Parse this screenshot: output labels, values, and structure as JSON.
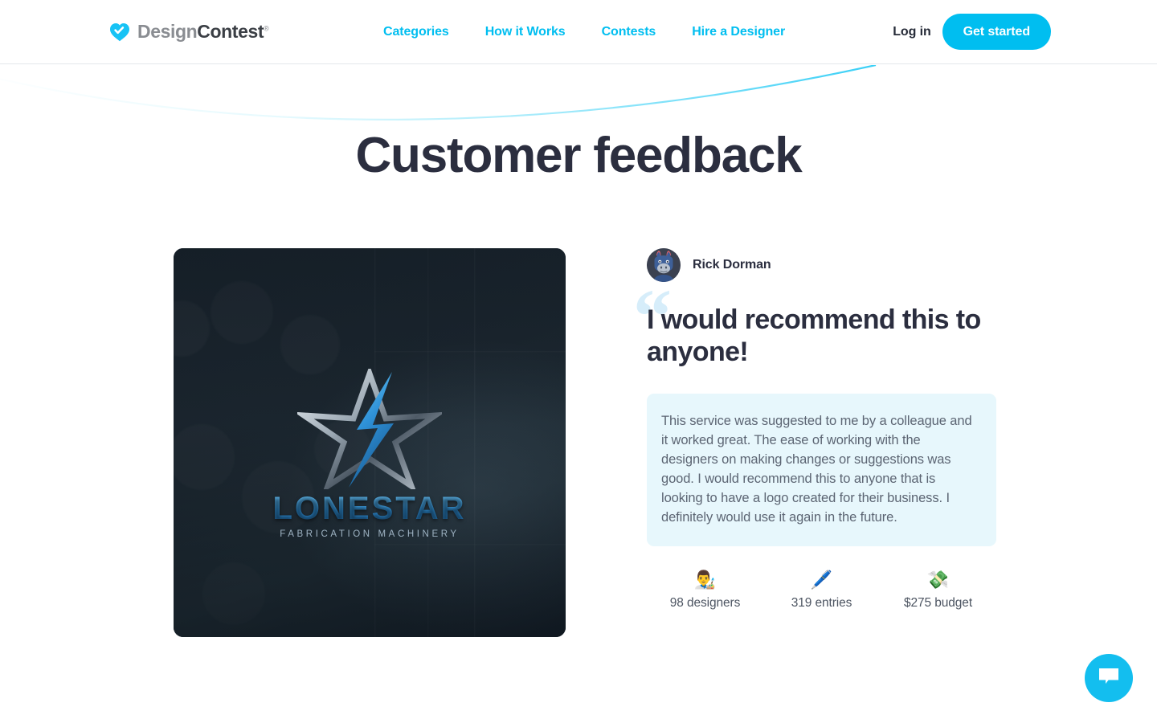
{
  "header": {
    "brand": {
      "icon": "heart-check-icon",
      "text_light": "Design",
      "text_dark": "Contest",
      "registered": "®"
    },
    "nav": [
      {
        "label": "Categories"
      },
      {
        "label": "How it Works"
      },
      {
        "label": "Contests"
      },
      {
        "label": "Hire a Designer"
      }
    ],
    "login_label": "Log in",
    "cta_label": "Get started",
    "accent_color": "#00bef0",
    "dark_text_color": "#262b38"
  },
  "page": {
    "title": "Customer feedback",
    "title_color": "#2b2e3f",
    "background": "#ffffff"
  },
  "preview": {
    "alt": "contest-winning-logo-preview",
    "logo_name": "LONESTAR",
    "logo_tagline": "FABRICATION MACHINERY",
    "card_bg": "#1b2630"
  },
  "testimonial": {
    "avatar_name": "donkey-avatar",
    "author": "Rick Dorman",
    "quote_glyph": "“",
    "quote_glyph_color": "#d6edfa",
    "headline": "I would recommend this to anyone!",
    "body": "This service was suggested to me by a colleague and it worked great. The ease of working with the designers on making changes or suggestions was good. I would recommend this to anyone that is looking to have a logo created for their business. I definitely would use it again in the future.",
    "body_bg": "#e7f7fc",
    "stats": [
      {
        "icon": "artist-emoji",
        "glyph": "👨‍🎨",
        "label": "98 designers"
      },
      {
        "icon": "pen-emoji",
        "glyph": "🖊️",
        "label": "319 entries"
      },
      {
        "icon": "money-with-wings-emoji",
        "glyph": "💸",
        "label": "$275 budget"
      }
    ]
  },
  "chat": {
    "icon": "chat-bubble-icon",
    "color": "#13beef"
  }
}
